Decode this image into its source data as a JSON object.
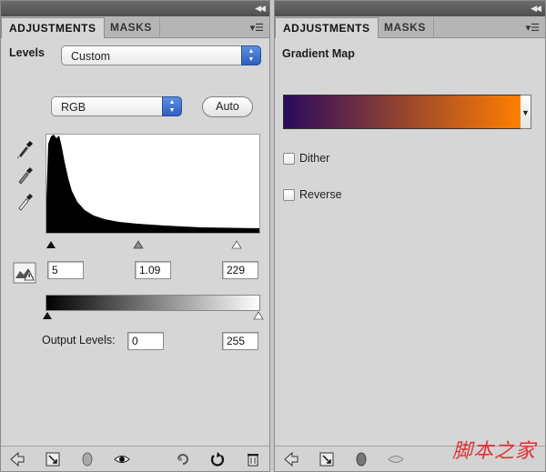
{
  "left_panel": {
    "tabs": [
      "ADJUSTMENTS",
      "MASKS"
    ],
    "adjustment_label": "Levels",
    "preset": {
      "value": "Custom"
    },
    "channel": {
      "value": "RGB"
    },
    "auto_button": "Auto",
    "input_levels": {
      "black": "5",
      "gamma": "1.09",
      "white": "229"
    },
    "output_levels_label": "Output Levels:",
    "output_levels": {
      "black": "0",
      "white": "255"
    }
  },
  "right_panel": {
    "tabs": [
      "ADJUSTMENTS",
      "MASKS"
    ],
    "adjustment_label": "Gradient Map",
    "gradient": {
      "start_color": "#2a0a5e",
      "end_color": "#ff7f00"
    },
    "options": [
      {
        "label": "Dither",
        "checked": false
      },
      {
        "label": "Reverse",
        "checked": false
      }
    ]
  },
  "colors": {
    "panel_bg": "#d6d6d6",
    "select_accent": "#3a6fd0"
  },
  "watermark": "脚本之家"
}
